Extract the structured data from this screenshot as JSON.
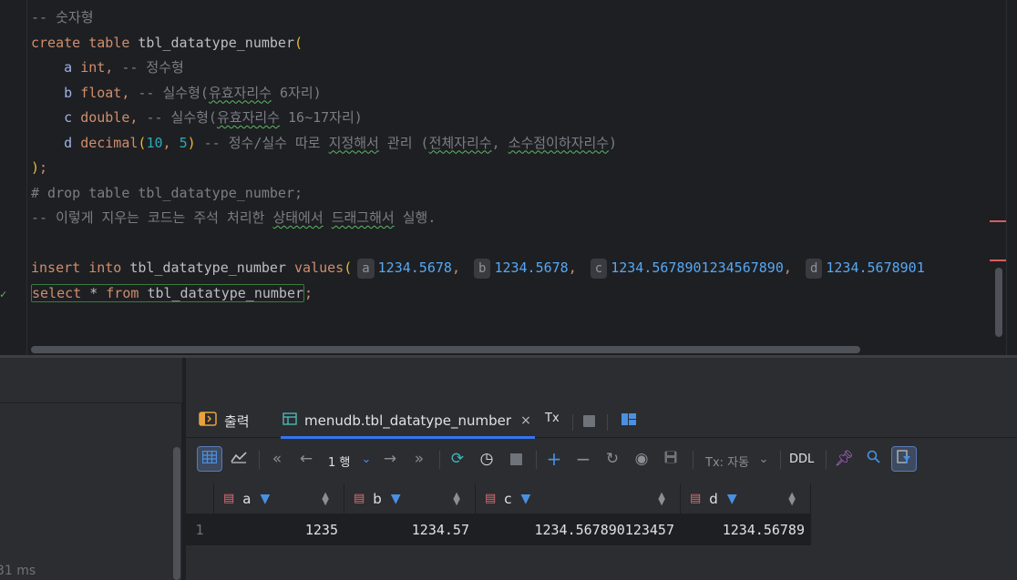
{
  "editor": {
    "lines": [
      [
        {
          "c": "cm",
          "t": "-- 숫자형"
        }
      ],
      [
        {
          "c": "kw",
          "t": "create table "
        },
        {
          "c": "pl",
          "t": "tbl_datatype_number"
        },
        {
          "c": "paren",
          "t": "("
        }
      ],
      [
        {
          "c": "pl",
          "t": "    "
        },
        {
          "c": "col",
          "t": "a "
        },
        {
          "c": "kw",
          "t": "int"
        },
        {
          "c": "kw",
          "t": ", "
        },
        {
          "c": "cm",
          "t": "-- 정수형"
        }
      ],
      [
        {
          "c": "pl",
          "t": "    "
        },
        {
          "c": "col",
          "t": "b "
        },
        {
          "c": "kw",
          "t": "float"
        },
        {
          "c": "kw",
          "t": ", "
        },
        {
          "c": "cm",
          "t": "-- 실수형("
        },
        {
          "c": "cm squig",
          "t": "유효자리수"
        },
        {
          "c": "cm",
          "t": " 6자리)"
        }
      ],
      [
        {
          "c": "pl",
          "t": "    "
        },
        {
          "c": "col",
          "t": "c "
        },
        {
          "c": "kw",
          "t": "double"
        },
        {
          "c": "kw",
          "t": ", "
        },
        {
          "c": "cm",
          "t": "-- 실수형("
        },
        {
          "c": "cm squig",
          "t": "유효자리수"
        },
        {
          "c": "cm",
          "t": " 16~17자리)"
        }
      ],
      [
        {
          "c": "pl",
          "t": "    "
        },
        {
          "c": "col",
          "t": "d "
        },
        {
          "c": "kw",
          "t": "decimal"
        },
        {
          "c": "paren",
          "t": "("
        },
        {
          "c": "nm",
          "t": "10"
        },
        {
          "c": "kw",
          "t": ", "
        },
        {
          "c": "nm",
          "t": "5"
        },
        {
          "c": "paren",
          "t": ")"
        },
        {
          "c": "cm",
          "t": " -- 정수/실수 따로 "
        },
        {
          "c": "cm squig",
          "t": "지정해서"
        },
        {
          "c": "cm",
          "t": " 관리 ("
        },
        {
          "c": "cm squig",
          "t": "전체자리수"
        },
        {
          "c": "cm",
          "t": ", "
        },
        {
          "c": "cm squig",
          "t": "소수점이하자리수"
        },
        {
          "c": "cm",
          "t": ")"
        }
      ],
      [
        {
          "c": "paren",
          "t": ")"
        },
        {
          "c": "kw",
          "t": ";"
        }
      ],
      [
        {
          "c": "cm",
          "t": "# drop table tbl_datatype_number;"
        }
      ],
      [
        {
          "c": "cm",
          "t": "-- 이렇게 지우는 코드는 주석 처리한 "
        },
        {
          "c": "cm squig",
          "t": "상태에서"
        },
        {
          "c": "cm",
          "t": " "
        },
        {
          "c": "cm squig",
          "t": "드래그해서"
        },
        {
          "c": "cm",
          "t": " 실행."
        }
      ],
      [
        {
          "c": "pl",
          "t": " "
        }
      ],
      [
        {
          "c": "kw",
          "t": "insert into "
        },
        {
          "c": "pl",
          "t": "tbl_datatype_number "
        },
        {
          "c": "kw",
          "t": "values"
        },
        {
          "c": "paren",
          "t": "("
        },
        {
          "c": "hint",
          "t": "a"
        },
        {
          "c": "val",
          "t": "1234.5678"
        },
        {
          "c": "kw",
          "t": ", "
        },
        {
          "c": "hint",
          "t": "b"
        },
        {
          "c": "val",
          "t": "1234.5678"
        },
        {
          "c": "kw",
          "t": ", "
        },
        {
          "c": "hint",
          "t": "c"
        },
        {
          "c": "val",
          "t": "1234.5678901234567890"
        },
        {
          "c": "kw",
          "t": ", "
        },
        {
          "c": "hint",
          "t": "d"
        },
        {
          "c": "val",
          "t": "1234.5678901"
        }
      ],
      [
        {
          "c": "active-stmt",
          "parts": [
            {
              "c": "kw",
              "t": "select "
            },
            {
              "c": "pl",
              "t": "* "
            },
            {
              "c": "kw",
              "t": "from "
            },
            {
              "c": "pl",
              "t": "tbl_datatype_number"
            }
          ]
        },
        {
          "c": "kw",
          "t": ";"
        }
      ]
    ],
    "gutter_mark": "✓"
  },
  "left_panel": {
    "elapsed": "31 ms"
  },
  "tabs": {
    "output_label": "출력",
    "table_label": "menudb.tbl_datatype_number",
    "close": "×",
    "tx": "Tx"
  },
  "toolbar": {
    "page": "1 행",
    "tx_mode": "Tx: 자동",
    "ddl": "DDL"
  },
  "grid": {
    "columns": [
      "a",
      "b",
      "c",
      "d"
    ],
    "rows": [
      {
        "num": "1",
        "values": [
          "1235",
          "1234.57",
          "1234.567890123457",
          "1234.56789"
        ]
      }
    ]
  },
  "colors": {
    "accent": "#3574f0",
    "keyword": "#cf8e6d",
    "comment": "#7a7e85",
    "number": "#2aacb8",
    "value": "#56a8f5"
  }
}
